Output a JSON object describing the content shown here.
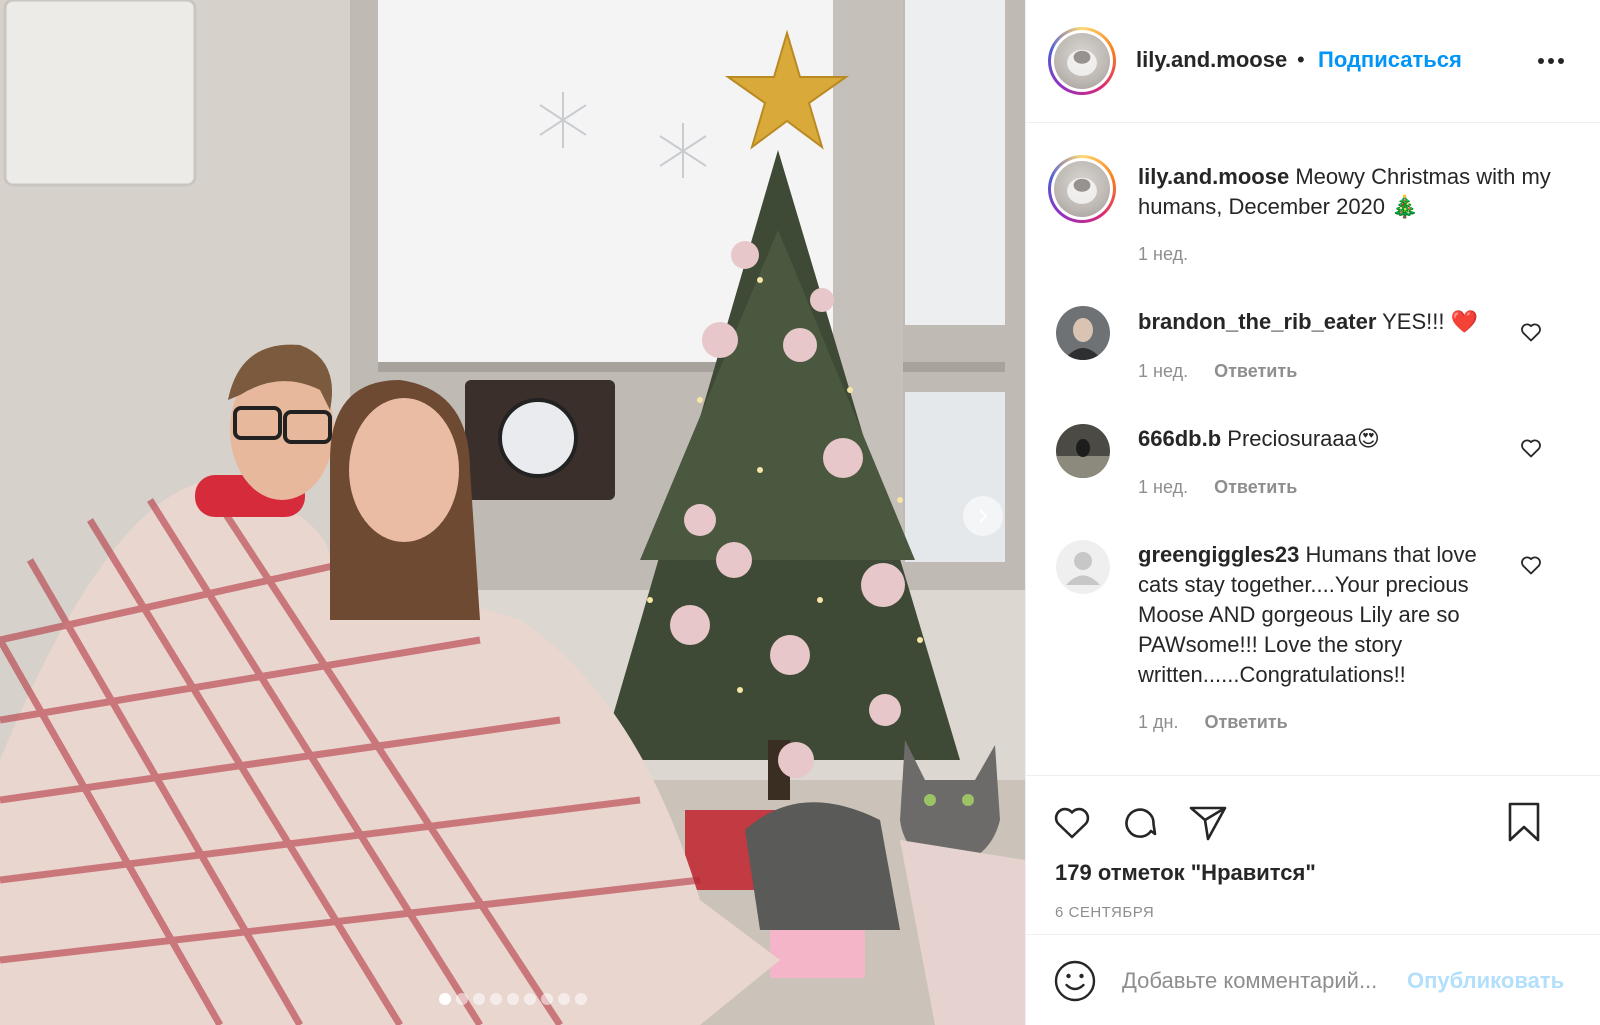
{
  "post": {
    "username": "lily.and.moose",
    "separator": "•",
    "follow_label": "Подписаться",
    "more_icon": "more-horizontal-icon"
  },
  "photo": {
    "next_icon": "chevron-right-icon",
    "slide_count": 9,
    "active_slide": 1
  },
  "caption": {
    "username": "lily.and.moose",
    "text": "Meowy Christmas with my humans, December 2020 🎄",
    "time": "1 нед."
  },
  "comments": [
    {
      "username": "brandon_the_rib_eater",
      "text": "YES!!! ❤️",
      "time": "1 нед.",
      "reply_label": "Ответить"
    },
    {
      "username": "666db.b",
      "text": "Preciosuraaa😍",
      "time": "1 нед.",
      "reply_label": "Ответить"
    },
    {
      "username": "greengiggles23",
      "text": "Humans that love cats stay together....Your precious Moose AND gorgeous Lily are so PAWsome!!! Love the story written......Congratulations!!",
      "time": "1 дн.",
      "reply_label": "Ответить"
    }
  ],
  "actions": {
    "likes_text": "179 отметок \"Нравится\"",
    "date_text": "6 СЕНТЯБРЯ"
  },
  "add_comment": {
    "placeholder": "Добавьте комментарий...",
    "publish_label": "Опубликовать"
  },
  "colors": {
    "accent": "#0095f6",
    "muted": "#8e8e8e",
    "text": "#262626",
    "publish_disabled": "#b2dffc"
  }
}
